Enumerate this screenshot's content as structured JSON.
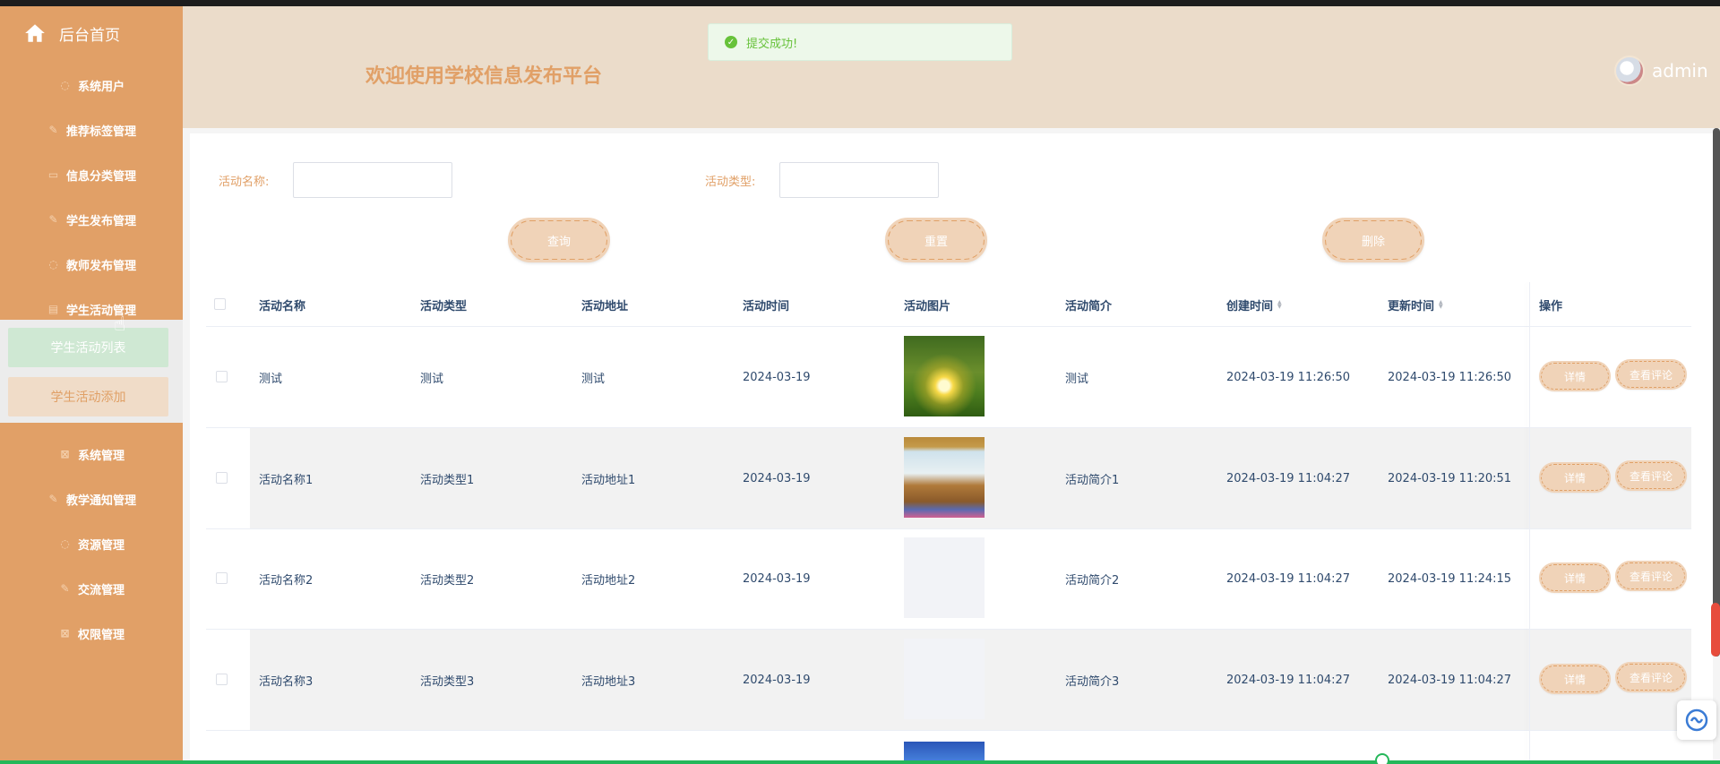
{
  "sidebar": {
    "home_label": "后台首页",
    "items": [
      {
        "label": "系统用户",
        "icon": "chat-bubble-icon"
      },
      {
        "label": "推荐标签管理",
        "icon": "edit-icon"
      },
      {
        "label": "信息分类管理",
        "icon": "chart-icon"
      },
      {
        "label": "学生发布管理",
        "icon": "edit-icon"
      },
      {
        "label": "教师发布管理",
        "icon": "chat-bubble-icon"
      },
      {
        "label": "学生活动管理",
        "icon": "doc-icon"
      },
      {
        "label": "系统管理",
        "icon": "close-box-icon"
      },
      {
        "label": "教学通知管理",
        "icon": "edit-icon"
      },
      {
        "label": "资源管理",
        "icon": "chat-bubble-icon"
      },
      {
        "label": "交流管理",
        "icon": "edit-icon"
      },
      {
        "label": "权限管理",
        "icon": "close-box-icon"
      }
    ],
    "submenu": [
      "学生活动列表",
      "学生活动添加"
    ]
  },
  "header": {
    "title": "欢迎使用学校信息发布平台",
    "username": "admin"
  },
  "toast": {
    "message": "提交成功!"
  },
  "search": {
    "name_label": "活动名称:",
    "type_label": "活动类型:",
    "query_button": "查询",
    "reset_button": "重置",
    "delete_button": "删除"
  },
  "table": {
    "headers": [
      "活动名称",
      "活动类型",
      "活动地址",
      "活动时间",
      "活动图片",
      "活动简介",
      "创建时间",
      "更新时间",
      "操作"
    ],
    "detail_label": "详情",
    "comment_label": "查看评论",
    "rows": [
      {
        "name": "测试",
        "type": "测试",
        "address": "测试",
        "time": "2024-03-19",
        "intro": "测试",
        "created": "2024-03-19 11:26:50",
        "updated": "2024-03-19 11:26:50",
        "image": "sunset-trees"
      },
      {
        "name": "活动名称1",
        "type": "活动类型1",
        "address": "活动地址1",
        "time": "2024-03-19",
        "intro": "活动简介1",
        "created": "2024-03-19 11:04:27",
        "updated": "2024-03-19 11:20:51",
        "image": "stage-performance"
      },
      {
        "name": "活动名称2",
        "type": "活动类型2",
        "address": "活动地址2",
        "time": "2024-03-19",
        "intro": "活动简介2",
        "created": "2024-03-19 11:04:27",
        "updated": "2024-03-19 11:24:15",
        "image": "blank"
      },
      {
        "name": "活动名称3",
        "type": "活动类型3",
        "address": "活动地址3",
        "time": "2024-03-19",
        "intro": "活动简介3",
        "created": "2024-03-19 11:04:27",
        "updated": "2024-03-19 11:04:27",
        "image": "blank"
      }
    ]
  },
  "colors": {
    "sidebar": "#e1a067",
    "header": "#ebdcca",
    "accent": "#e0a066",
    "text": "#2f4a6d",
    "success": "#67c23a"
  }
}
